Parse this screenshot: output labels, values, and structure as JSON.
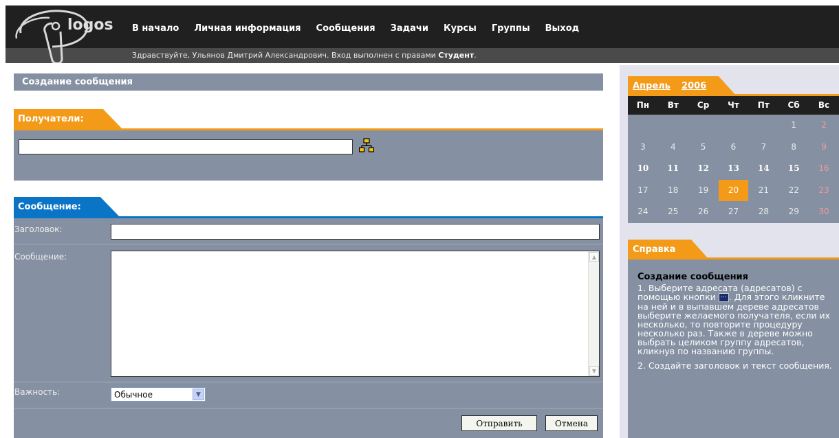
{
  "header": {
    "logo_text": "logos",
    "nav": [
      "В начало",
      "Личная информация",
      "Сообщения",
      "Задачи",
      "Курсы",
      "Группы",
      "Выход"
    ],
    "greeting_prefix": "Здравствуйте, Ульянов Дмитрий Александрович.  Вход выполнен с правами",
    "greeting_role": "Студент",
    "greeting_suffix": "."
  },
  "main": {
    "page_title": "Создание сообщения",
    "recipients_tab": "Получатели:",
    "recipients_value": "",
    "message_tab": "Сообщение:",
    "subject_label": "Заголовок:",
    "subject_value": "",
    "body_label": "Сообщение:",
    "body_value": "",
    "importance_label": "Важность:",
    "importance_value": "Обычное",
    "send_label": "Отправить",
    "cancel_label": "Отмена"
  },
  "calendar": {
    "month": "Апрель",
    "year": "2006",
    "weekdays": [
      "Пн",
      "Вт",
      "Ср",
      "Чт",
      "Пт",
      "Сб",
      "Вс"
    ],
    "weeks": [
      [
        "",
        "",
        "",
        "",
        "",
        "1",
        "2"
      ],
      [
        "3",
        "4",
        "5",
        "6",
        "7",
        "8",
        "9"
      ],
      [
        "10",
        "11",
        "12",
        "13",
        "14",
        "15",
        "16"
      ],
      [
        "17",
        "18",
        "19",
        "20",
        "21",
        "22",
        "23"
      ],
      [
        "24",
        "25",
        "26",
        "27",
        "28",
        "29",
        "30"
      ]
    ],
    "today": "20",
    "bold_days": [
      "10",
      "11",
      "12",
      "13",
      "14",
      "15"
    ]
  },
  "help": {
    "tab": "Справка",
    "title": "Создание сообщения",
    "p1_before": "1. Выберите адресата (адресатов) с помощью кнопки",
    "p1_after": ". Для этого кликните на ней и в выпавшем дереве адресатов выберите желаемого получателя, если их несколько, то повторите процедуру несколько раз. Также в дереве можно выбрать целиком группу адресатов, кликнув по названию группы.",
    "p2": "2. Создайте заголовок и текст сообщения."
  },
  "colors": {
    "orange": "#f39b18",
    "blue": "#0a74c6",
    "panel": "#8591a2",
    "dark": "#202020"
  }
}
